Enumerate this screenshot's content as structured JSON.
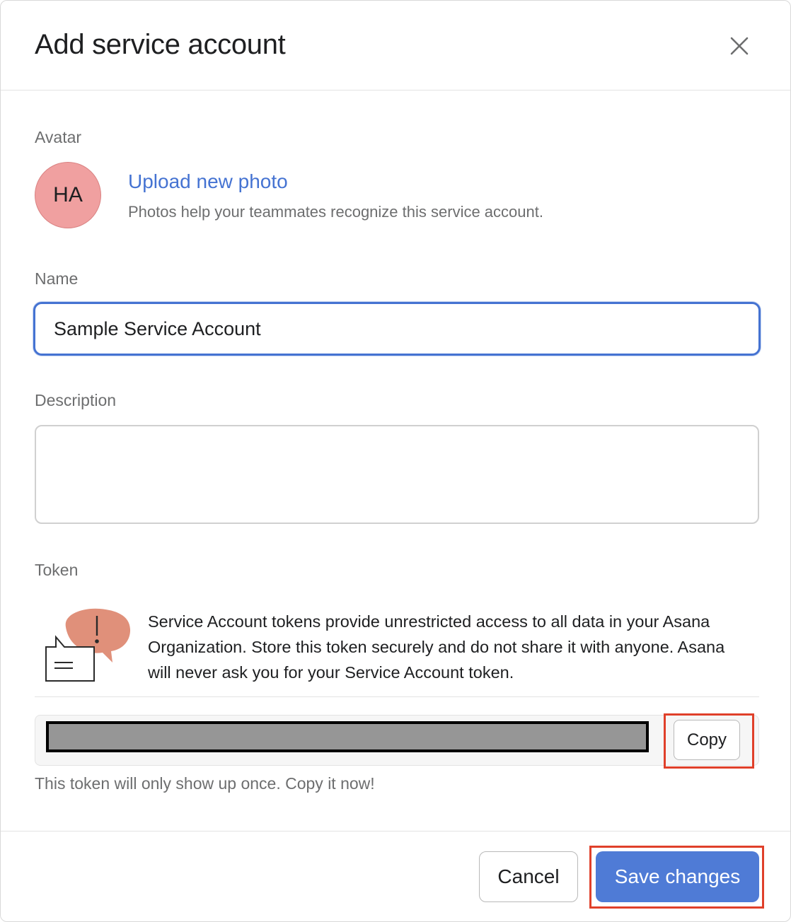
{
  "dialog": {
    "title": "Add service account",
    "close_icon": "close-icon"
  },
  "avatar": {
    "label": "Avatar",
    "initials": "HA",
    "color": "#f0a0a0",
    "upload_link": "Upload new photo",
    "help_text": "Photos help your teammates recognize this service account."
  },
  "name": {
    "label": "Name",
    "value": "Sample Service Account"
  },
  "description": {
    "label": "Description",
    "value": ""
  },
  "token": {
    "label": "Token",
    "illustration_icon": "warning-chat-icon",
    "warning": "Service Account tokens provide unrestricted access to all data in your Asana Organization. Store this token securely and do not share it with anyone. Asana will never ask you for your Service Account token.",
    "copy_label": "Copy",
    "note": "This token will only show up once. Copy it now!"
  },
  "footer": {
    "cancel_label": "Cancel",
    "save_label": "Save changes"
  },
  "colors": {
    "accent": "#4573d2",
    "primary_button": "#4f7bd6",
    "highlight": "#e0402a"
  }
}
